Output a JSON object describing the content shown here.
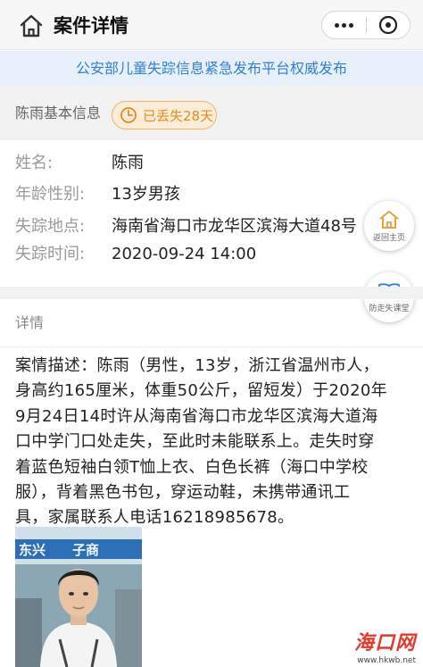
{
  "header": {
    "title": "案件详情"
  },
  "banner": {
    "text": "公安部儿童失踪信息紧急发布平台权威发布"
  },
  "info": {
    "section_title": "陈雨基本信息",
    "badge": "已丢失28天",
    "fields": [
      {
        "label": "姓名:",
        "value": "陈雨"
      },
      {
        "label": "年龄性别:",
        "value": "13岁男孩"
      },
      {
        "label": "失踪地点:",
        "value": "海南省海口市龙华区滨海大道48号"
      },
      {
        "label": "失踪时间:",
        "value": "2020-09-24 14:00"
      }
    ]
  },
  "float_buttons": {
    "home_label": "返回主页",
    "class_label": "防走失课堂"
  },
  "detail": {
    "section_title": "详情",
    "lines": [
      "案情描述：陈雨（男性，13岁，浙江省温州市人，",
      "身高约165厘米，体重50公斤，留短发）于2020年",
      "9月24日14时许从海南省海口市龙华区滨海大道海",
      "口中学门口处走失，至此时未能联系上。走失时穿",
      "着蓝色短袖白领T恤上衣、白色长裤（海口中学校",
      "服），背着黑色书包，穿运动鞋，未携带通讯工",
      "具，家属联系人电话16218985678。"
    ]
  },
  "photo": {
    "backdrop_text": "东兴　　子商"
  },
  "watermark": {
    "logo": "海口网",
    "url": "www.hkwb.net"
  },
  "colors": {
    "accent_blue": "#2f7fd6",
    "badge_orange": "#ea8a1e",
    "banner_bg": "#e8f1fb"
  }
}
